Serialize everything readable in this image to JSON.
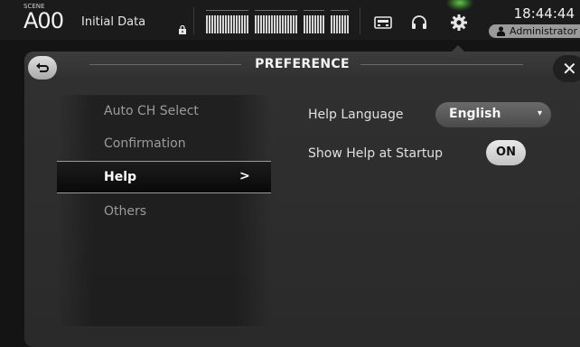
{
  "status_bar": {
    "scene_label": "SCENE",
    "scene_number": "A00",
    "scene_title": "Initial Data",
    "clock": "18:44:44",
    "user": "Administrator",
    "icons": [
      "lock-icon",
      "recorder-icon",
      "headphones-icon",
      "gear-icon",
      "user-icon"
    ]
  },
  "panel": {
    "title": "PREFERENCE",
    "back_icon": "return-arrow-icon",
    "close_icon": "close-icon",
    "close_glyph": "✕"
  },
  "menu": {
    "items": [
      {
        "label": "Auto CH Select",
        "selected": false
      },
      {
        "label": "Confirmation",
        "selected": false
      },
      {
        "label": "Help",
        "selected": true
      },
      {
        "label": "Others",
        "selected": false
      }
    ],
    "selected_arrow": ">"
  },
  "settings": {
    "help_language": {
      "label": "Help Language",
      "value": "English",
      "caret": "▾"
    },
    "show_help_at_startup": {
      "label": "Show Help at Startup",
      "value": "ON"
    }
  },
  "colors": {
    "background": "#141414",
    "panel": "#303030",
    "accent_glow": "#78ff5a",
    "selected_text": "#ffffff",
    "inactive_text": "#9b9b9b"
  }
}
